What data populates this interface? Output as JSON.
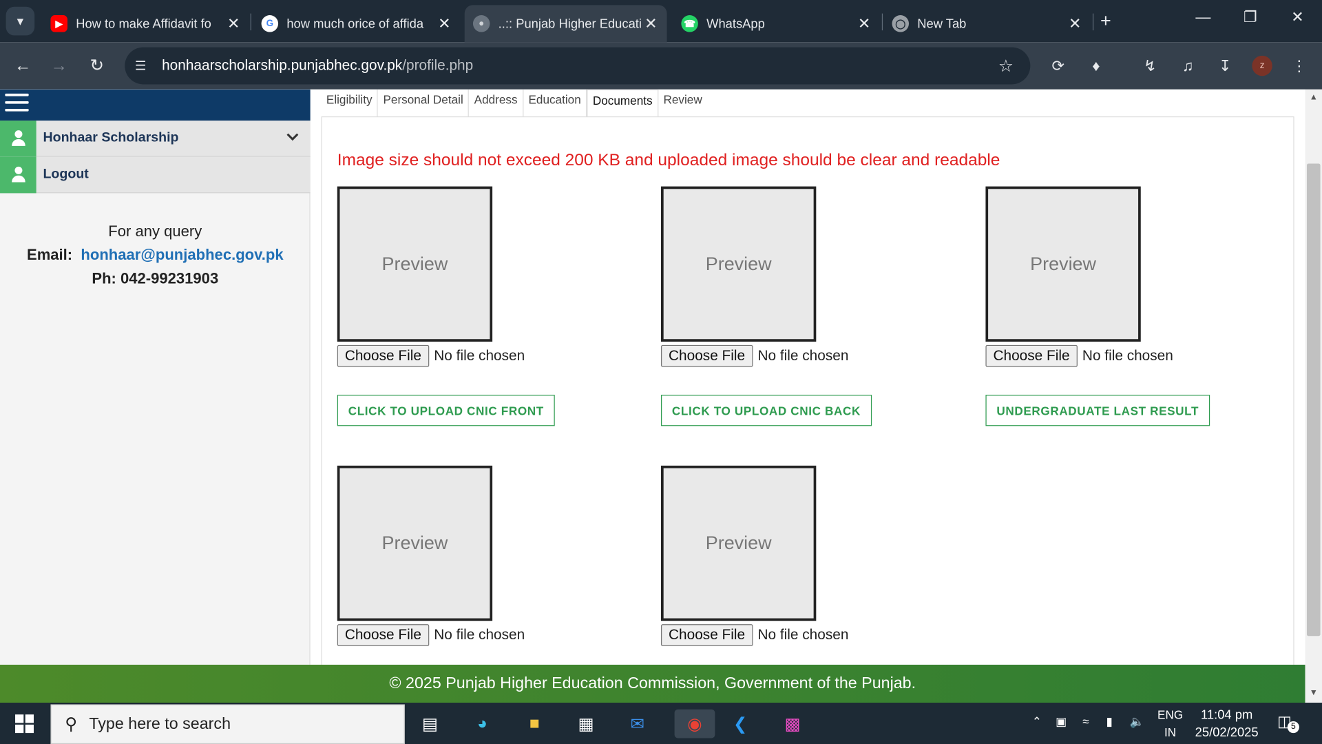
{
  "browser": {
    "tabs": [
      {
        "title": "How to make Affidavit fo",
        "icon": "youtube-icon"
      },
      {
        "title": "how much orice of affida",
        "icon": "google-icon"
      },
      {
        "title": "..:: Punjab Higher Educati",
        "icon": "globe-icon"
      },
      {
        "title": "WhatsApp",
        "icon": "whatsapp-icon"
      },
      {
        "title": "New Tab",
        "icon": "chrome-icon"
      }
    ],
    "url_host": "honhaarscholarship.punjabhec.gov.pk",
    "url_path": "/profile.php",
    "profile_initial": "z"
  },
  "sidebar": {
    "items": [
      {
        "label": "Honhaar Scholarship"
      },
      {
        "label": "Logout"
      }
    ],
    "query_title": "For any query",
    "email_label": "Email:",
    "email": "honhaar@punjabhec.gov.pk",
    "phone": "Ph: 042-99231903"
  },
  "form_tabs": [
    "Eligibility",
    "Personal Detail",
    "Address",
    "Education",
    "Documents",
    "Review"
  ],
  "active_tab": "Documents",
  "warning": "Image size should not exceed 200 KB and uploaded image should be clear and readable",
  "slots": [
    {
      "preview": "Preview",
      "choose": "Choose File",
      "status": "No file chosen",
      "button": "CLICK TO UPLOAD CNIC FRONT"
    },
    {
      "preview": "Preview",
      "choose": "Choose File",
      "status": "No file chosen",
      "button": "CLICK TO UPLOAD CNIC BACK"
    },
    {
      "preview": "Preview",
      "choose": "Choose File",
      "status": "No file chosen",
      "button": "UNDERGRADUATE LAST RESULT"
    },
    {
      "preview": "Preview",
      "choose": "Choose File",
      "status": "No file chosen"
    },
    {
      "preview": "Preview",
      "choose": "Choose File",
      "status": "No file chosen"
    }
  ],
  "footer": "© 2025 Punjab Higher Education Commission, Government of the Punjab.",
  "taskbar": {
    "search_placeholder": "Type here to search",
    "lang_top": "ENG",
    "lang_bottom": "IN",
    "time": "11:04 pm",
    "date": "25/02/2025",
    "notification_count": "5"
  }
}
